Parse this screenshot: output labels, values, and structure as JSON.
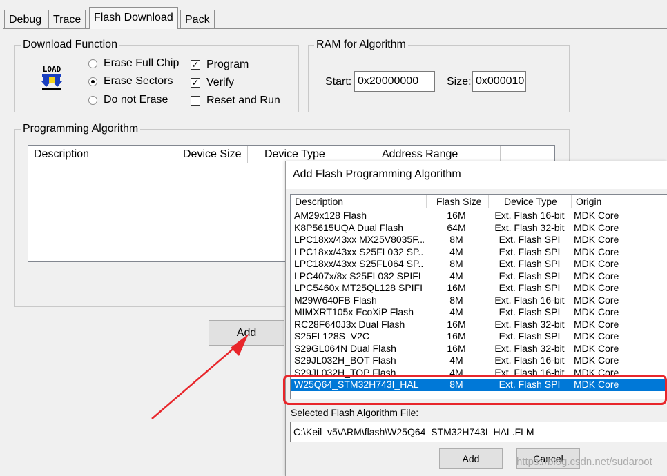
{
  "tabs": [
    {
      "label": "Debug"
    },
    {
      "label": "Trace"
    },
    {
      "label": "Flash Download"
    },
    {
      "label": "Pack"
    }
  ],
  "download_function": {
    "title": "Download Function",
    "load_icon_text": "LOAD",
    "radios": [
      {
        "label": "Erase Full Chip",
        "selected": false
      },
      {
        "label": "Erase Sectors",
        "selected": true
      },
      {
        "label": "Do not Erase",
        "selected": false
      }
    ],
    "checks": [
      {
        "label": "Program",
        "checked": true
      },
      {
        "label": "Verify",
        "checked": true
      },
      {
        "label": "Reset and Run",
        "checked": false
      }
    ]
  },
  "ram": {
    "title": "RAM for Algorithm",
    "start_label": "Start:",
    "start_value": "0x20000000",
    "size_label": "Size:",
    "size_value": "0x000010"
  },
  "programming_algorithm": {
    "title": "Programming Algorithm",
    "columns": [
      "Description",
      "Device Size",
      "Device Type",
      "Address Range"
    ],
    "add_label": "Add"
  },
  "dialog": {
    "title": "Add Flash Programming Algorithm",
    "columns": [
      "Description",
      "Flash Size",
      "Device Type",
      "Origin"
    ],
    "rows": [
      [
        "AM29x128 Flash",
        "16M",
        "Ext. Flash 16-bit",
        "MDK Core"
      ],
      [
        "K8P5615UQA Dual Flash",
        "64M",
        "Ext. Flash 32-bit",
        "MDK Core"
      ],
      [
        "LPC18xx/43xx MX25V8035F...",
        "8M",
        "Ext. Flash SPI",
        "MDK Core"
      ],
      [
        "LPC18xx/43xx S25FL032 SP...",
        "4M",
        "Ext. Flash SPI",
        "MDK Core"
      ],
      [
        "LPC18xx/43xx S25FL064 SP...",
        "8M",
        "Ext. Flash SPI",
        "MDK Core"
      ],
      [
        "LPC407x/8x S25FL032 SPIFI",
        "4M",
        "Ext. Flash SPI",
        "MDK Core"
      ],
      [
        "LPC5460x MT25QL128 SPIFI",
        "16M",
        "Ext. Flash SPI",
        "MDK Core"
      ],
      [
        "M29W640FB Flash",
        "8M",
        "Ext. Flash 16-bit",
        "MDK Core"
      ],
      [
        "MIMXRT105x EcoXiP Flash",
        "4M",
        "Ext. Flash SPI",
        "MDK Core"
      ],
      [
        "RC28F640J3x Dual Flash",
        "16M",
        "Ext. Flash 32-bit",
        "MDK Core"
      ],
      [
        "S25FL128S_V2C",
        "16M",
        "Ext. Flash SPI",
        "MDK Core"
      ],
      [
        "S29GL064N Dual Flash",
        "16M",
        "Ext. Flash 32-bit",
        "MDK Core"
      ],
      [
        "S29JL032H_BOT Flash",
        "4M",
        "Ext. Flash 16-bit",
        "MDK Core"
      ],
      [
        "S29JL032H_TOP Flash",
        "4M",
        "Ext. Flash 16-bit",
        "MDK Core"
      ],
      [
        "W25Q64_STM32H743I_HAL",
        "8M",
        "Ext. Flash SPI",
        "MDK Core"
      ]
    ],
    "selected_index": 14,
    "selected_file_label": "Selected Flash Algorithm File:",
    "selected_file_value": "C:\\Keil_v5\\ARM\\flash\\W25Q64_STM32H743I_HAL.FLM",
    "add_label": "Add",
    "cancel_label": "Cancel"
  },
  "watermark": "https://blog.csdn.net/sudaroot",
  "colors": {
    "selection": "#0078d7",
    "highlight": "#e8262b"
  }
}
